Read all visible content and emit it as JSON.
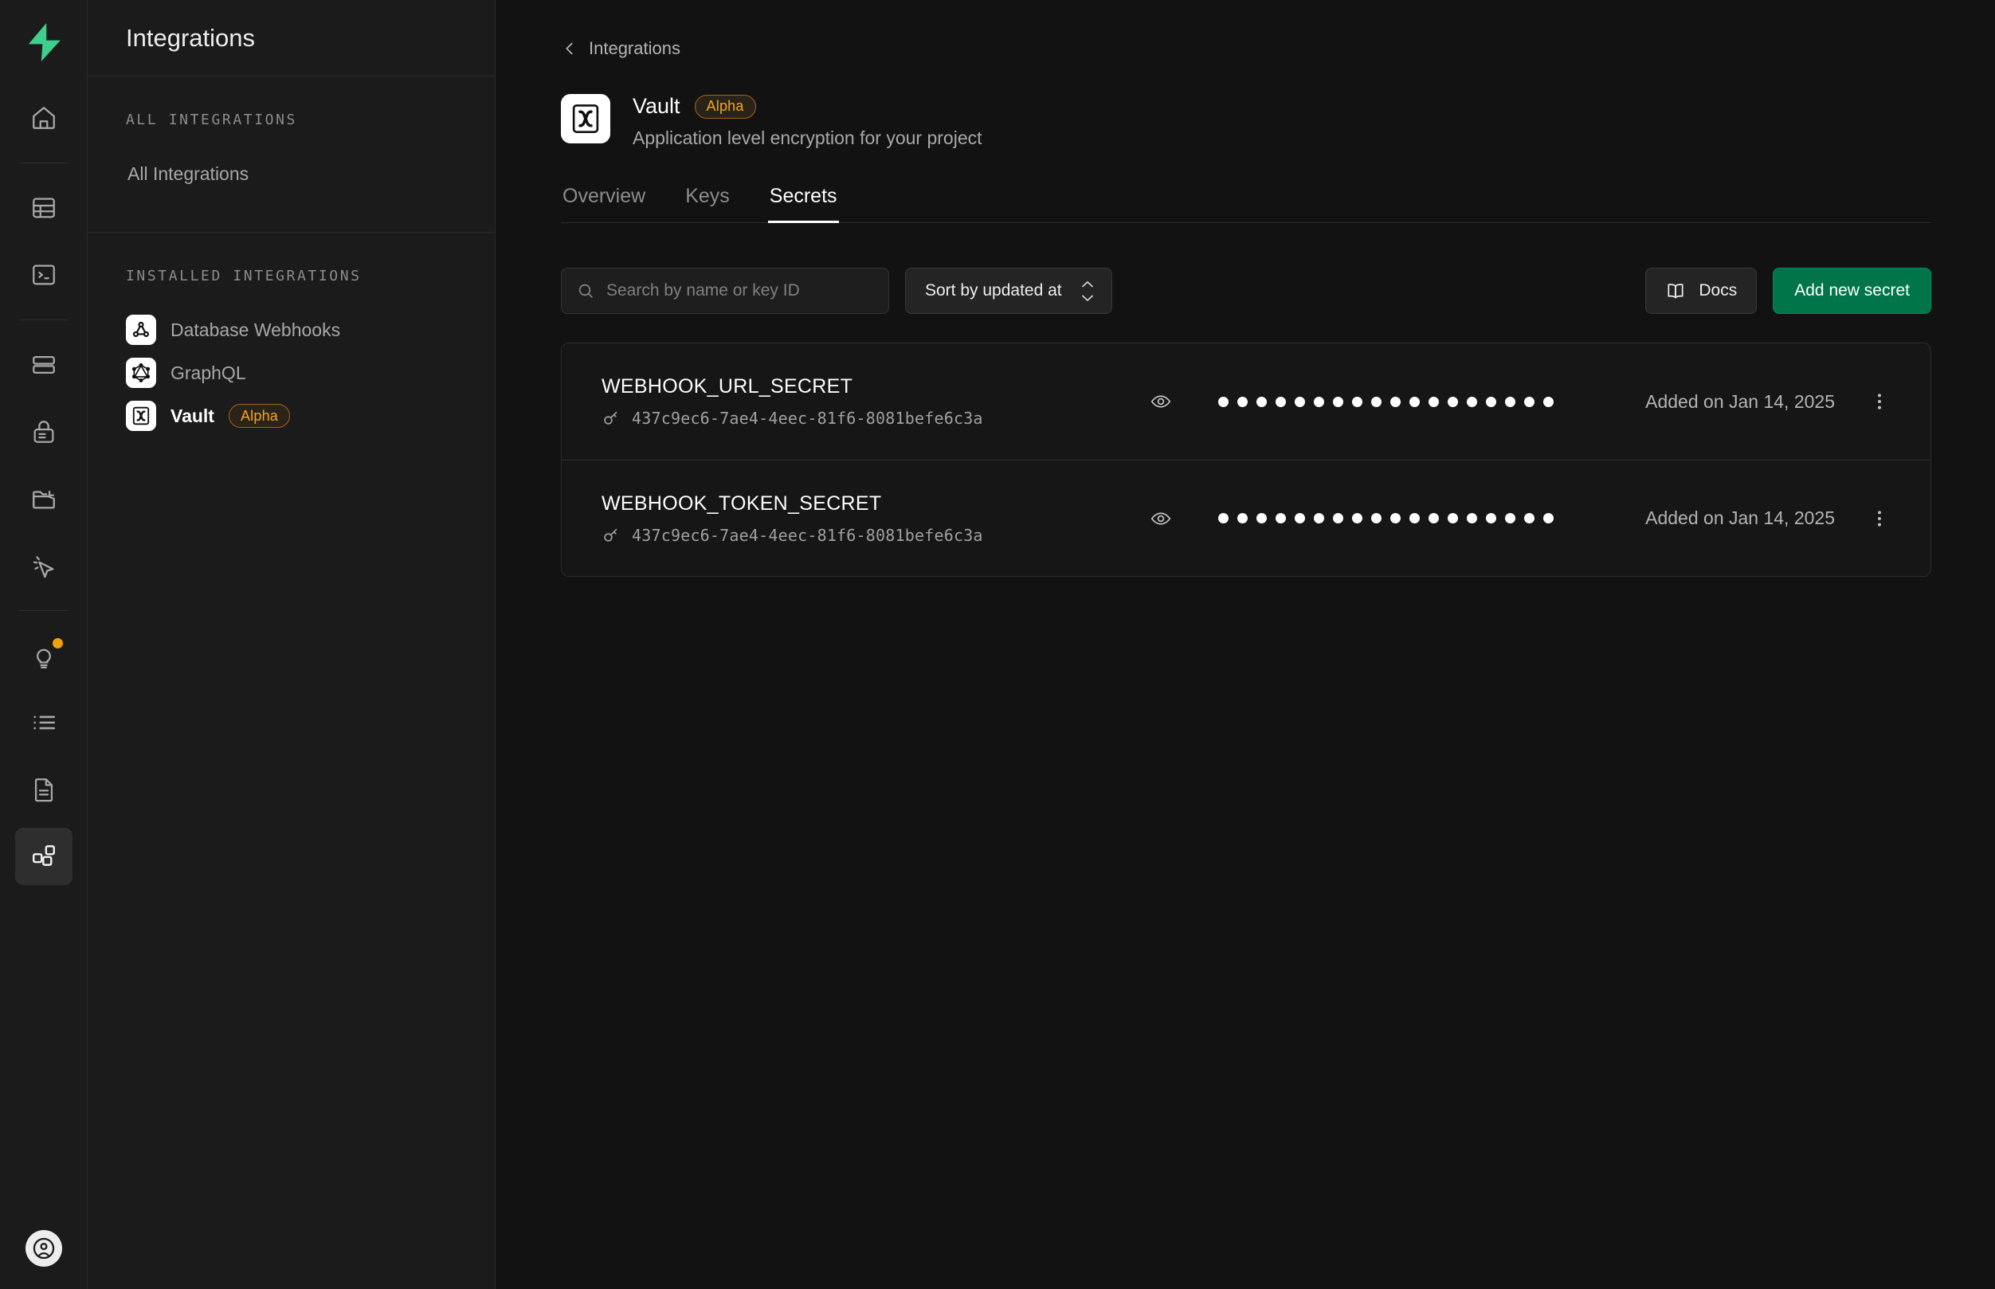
{
  "rail": {
    "brand_icon": "supabase-logo",
    "items": [
      {
        "icon": "home-icon",
        "name": "home",
        "active": false,
        "badge": false
      },
      {
        "icon": "table-editor-icon",
        "name": "table-editor",
        "active": false,
        "badge": false
      },
      {
        "icon": "sql-editor-icon",
        "name": "sql-editor",
        "active": false,
        "badge": false
      },
      {
        "icon": "database-icon",
        "name": "database",
        "active": false,
        "badge": false
      },
      {
        "icon": "authentication-lock-icon",
        "name": "authentication",
        "active": false,
        "badge": false
      },
      {
        "icon": "storage-folder-icon",
        "name": "storage",
        "active": false,
        "badge": false
      },
      {
        "icon": "edge-functions-cursor-icon",
        "name": "edge-functions",
        "active": false,
        "badge": false
      },
      {
        "icon": "advisors-lightbulb-icon",
        "name": "advisors",
        "active": false,
        "badge": true
      },
      {
        "icon": "logs-list-icon",
        "name": "logs",
        "active": false,
        "badge": false
      },
      {
        "icon": "reports-document-icon",
        "name": "reports",
        "active": false,
        "badge": false
      },
      {
        "icon": "integrations-blocks-icon",
        "name": "integrations",
        "active": true,
        "badge": false
      }
    ],
    "avatar_icon": "account-avatar-icon"
  },
  "sidebar": {
    "title": "Integrations",
    "sections": [
      {
        "label": "ALL INTEGRATIONS",
        "items": [
          {
            "label": "All Integrations",
            "icon": null,
            "badge": null,
            "active": false
          }
        ]
      },
      {
        "label": "INSTALLED INTEGRATIONS",
        "items": [
          {
            "label": "Database Webhooks",
            "icon": "webhook-icon",
            "badge": null,
            "active": false
          },
          {
            "label": "GraphQL",
            "icon": "graphql-icon",
            "badge": null,
            "active": false
          },
          {
            "label": "Vault",
            "icon": "vault-icon",
            "badge": "Alpha",
            "active": true
          }
        ]
      }
    ]
  },
  "main": {
    "breadcrumb": {
      "back_icon": "chevron-left-icon",
      "label": "Integrations"
    },
    "header": {
      "icon": "vault-icon",
      "title": "Vault",
      "badge": "Alpha",
      "subtitle": "Application level encryption for your project"
    },
    "tabs": [
      {
        "label": "Overview",
        "active": false
      },
      {
        "label": "Keys",
        "active": false
      },
      {
        "label": "Secrets",
        "active": true
      }
    ],
    "toolbar": {
      "search_placeholder": "Search by name or key ID",
      "search_value": "",
      "search_icon": "search-icon",
      "sort_label": "Sort by updated at",
      "sort_icon": "chevron-up-down-icon",
      "docs_label": "Docs",
      "docs_icon": "book-icon",
      "add_label": "Add new secret"
    },
    "secrets": [
      {
        "name": "WEBHOOK_URL_SECRET",
        "key_icon": "key-icon",
        "key_id": "437c9ec6-7ae4-4eec-81f6-8081befe6c3a",
        "reveal_icon": "eye-icon",
        "masked_dots": 18,
        "added_on": "Added on Jan 14, 2025",
        "menu_icon": "kebab-menu-icon"
      },
      {
        "name": "WEBHOOK_TOKEN_SECRET",
        "key_icon": "key-icon",
        "key_id": "437c9ec6-7ae4-4eec-81f6-8081befe6c3a",
        "reveal_icon": "eye-icon",
        "masked_dots": 18,
        "added_on": "Added on Jan 14, 2025",
        "menu_icon": "kebab-menu-icon"
      }
    ]
  },
  "colors": {
    "background": "#121212",
    "panel": "#1b1b1b",
    "border": "#2a2a2a",
    "brand_green": "#3ecf8e",
    "primary_button": "#00754a",
    "alpha_badge": "#f5a623",
    "badge_dot": "#f0a202",
    "text_primary": "#fdfdfd",
    "text_muted": "#8c8c8c"
  }
}
